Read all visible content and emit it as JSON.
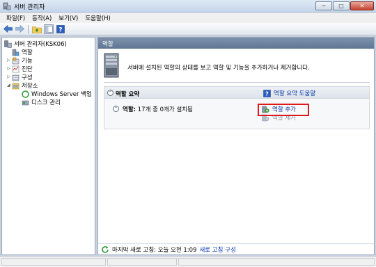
{
  "window": {
    "title": "서버 관리자",
    "controls": {
      "minimize": "─",
      "maximize": "□",
      "close": "✕"
    }
  },
  "menu": [
    {
      "label": "파일(F)"
    },
    {
      "label": "동작(A)"
    },
    {
      "label": "보기(V)"
    },
    {
      "label": "도움말(H)"
    }
  ],
  "toolbar": {
    "items": [
      "back-arrow-icon",
      "forward-arrow-icon",
      "up-folder-icon",
      "console-tree-icon",
      "help-icon"
    ]
  },
  "tree": {
    "root": "서버 관리자(KSK06)",
    "items": [
      {
        "label": "역할"
      },
      {
        "label": "기능"
      },
      {
        "label": "진단"
      },
      {
        "label": "구성"
      },
      {
        "label": "저장소"
      },
      {
        "label": "Windows Server 백업"
      },
      {
        "label": "디스크 관리"
      }
    ]
  },
  "content": {
    "header": "역할",
    "description": "서버에 설치된 역할의 상태를 보고 역할 및 기능을 추가하거나 제거합니다.",
    "section": {
      "title": "역할 요약",
      "help_link": "역할 요약 도움말",
      "summary_label": "역할:",
      "summary_text": "17개 중 0개가 설치됨",
      "actions": [
        {
          "label": "역할 추가",
          "enabled": true
        },
        {
          "label": "역할 제거",
          "enabled": false
        }
      ]
    },
    "status": {
      "text": "마지막 새로 고침: 오늘 오전 1:09",
      "link": "새로 고침 구성"
    }
  },
  "colors": {
    "link": "#0033aa",
    "highlight": "#e0191c",
    "header": "#6b809c"
  }
}
